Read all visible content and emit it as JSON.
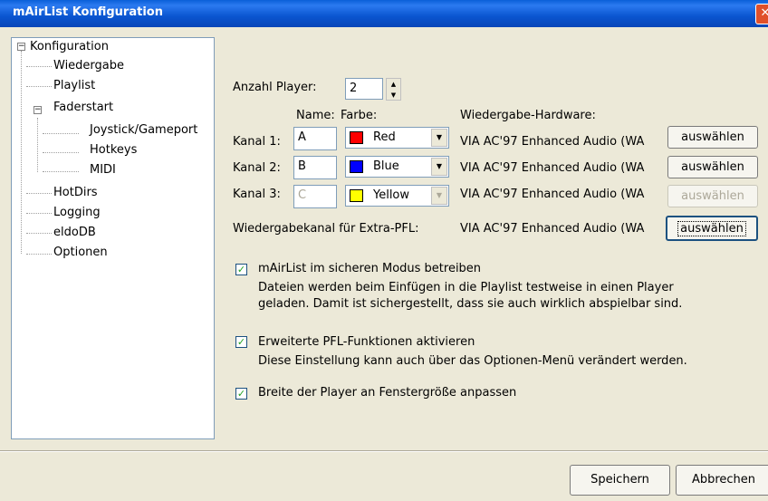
{
  "window": {
    "title": "mAirList Konfiguration",
    "close_symbol": "✕"
  },
  "tree": {
    "items": [
      {
        "label": "Konfiguration",
        "expander": "−"
      },
      {
        "label": "Wiedergabe"
      },
      {
        "label": "Playlist"
      },
      {
        "label": "Faderstart",
        "expander": "−"
      },
      {
        "label": "Joystick/Gameport"
      },
      {
        "label": "Hotkeys"
      },
      {
        "label": "MIDI"
      },
      {
        "label": "HotDirs"
      },
      {
        "label": "Logging"
      },
      {
        "label": "eldoDB"
      },
      {
        "label": "Optionen"
      }
    ]
  },
  "settings": {
    "player_count_label": "Anzahl Player:",
    "player_count_value": "2",
    "col_name": "Name:",
    "col_color": "Farbe:",
    "col_hardware": "Wiedergabe-Hardware:",
    "channels": [
      {
        "label": "Kanal 1:",
        "name": "A",
        "color_name": "Red",
        "color_hex": "#ff0000",
        "hardware": "VIA AC'97 Enhanced Audio (WA",
        "button": "auswählen",
        "enabled": true
      },
      {
        "label": "Kanal 2:",
        "name": "B",
        "color_name": "Blue",
        "color_hex": "#0000ff",
        "hardware": "VIA AC'97 Enhanced Audio (WA",
        "button": "auswählen",
        "enabled": true
      },
      {
        "label": "Kanal 3:",
        "name": "C",
        "color_name": "Yellow",
        "color_hex": "#ffff00",
        "hardware": "VIA AC'97 Enhanced Audio (WA",
        "button": "auswählen",
        "enabled": false
      }
    ],
    "pfl": {
      "label": "Wiedergabekanal für Extra-PFL:",
      "hardware": "VIA AC'97 Enhanced Audio (WA",
      "button": "auswählen"
    },
    "options": [
      {
        "label": "mAirList im sicheren Modus betreiben",
        "checked": true,
        "desc1": "Dateien werden beim Einfügen in die Playlist testweise in einen Player",
        "desc2": "geladen. Damit ist sichergestellt, dass sie auch wirklich abspielbar sind."
      },
      {
        "label": "Erweiterte PFL-Funktionen aktivieren",
        "checked": true,
        "desc1": "Diese Einstellung kann auch über das Optionen-Menü verändert werden."
      },
      {
        "label": "Breite der Player an Fenstergröße anpassen",
        "checked": true
      }
    ]
  },
  "footer": {
    "save": "Speichern",
    "cancel": "Abbrechen"
  }
}
